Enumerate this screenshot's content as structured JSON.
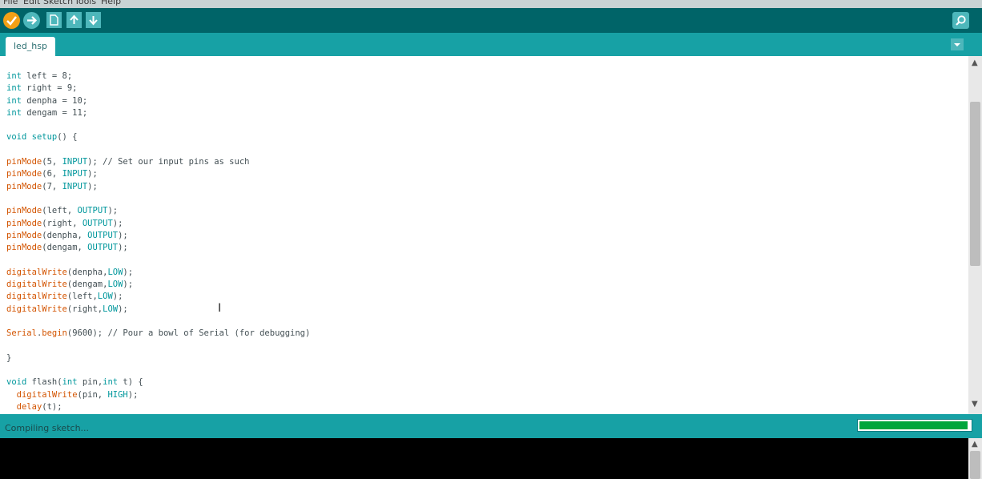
{
  "menu": [
    "File",
    "Edit",
    "Sketch",
    "Tools",
    "Help"
  ],
  "toolbar": {
    "verify": "check-icon",
    "upload": "arrow-right-icon",
    "new": "new-file-icon",
    "open": "open-arrow-up-icon",
    "save": "save-arrow-down-icon",
    "serial_monitor": "magnifier-icon"
  },
  "tabs": [
    {
      "label": "led_hsp",
      "active": true
    }
  ],
  "code_lines": [
    [
      {
        "t": "int",
        "c": "kw"
      },
      {
        "t": " left = 8;"
      }
    ],
    [
      {
        "t": "int",
        "c": "kw"
      },
      {
        "t": " right = 9;"
      }
    ],
    [
      {
        "t": "int",
        "c": "kw"
      },
      {
        "t": " denpha = 10;"
      }
    ],
    [
      {
        "t": "int",
        "c": "kw"
      },
      {
        "t": " dengam = 11;"
      }
    ],
    [],
    [
      {
        "t": "void",
        "c": "kw"
      },
      {
        "t": " "
      },
      {
        "t": "setup",
        "c": "kw"
      },
      {
        "t": "() {"
      }
    ],
    [],
    [
      {
        "t": "pinMode",
        "c": "fn"
      },
      {
        "t": "(5, "
      },
      {
        "t": "INPUT",
        "c": "kw"
      },
      {
        "t": "); "
      },
      {
        "t": "// Set our input pins as such",
        "c": "cm"
      }
    ],
    [
      {
        "t": "pinMode",
        "c": "fn"
      },
      {
        "t": "(6, "
      },
      {
        "t": "INPUT",
        "c": "kw"
      },
      {
        "t": ");"
      }
    ],
    [
      {
        "t": "pinMode",
        "c": "fn"
      },
      {
        "t": "(7, "
      },
      {
        "t": "INPUT",
        "c": "kw"
      },
      {
        "t": ");"
      }
    ],
    [],
    [
      {
        "t": "pinMode",
        "c": "fn"
      },
      {
        "t": "(left, "
      },
      {
        "t": "OUTPUT",
        "c": "kw"
      },
      {
        "t": ");"
      }
    ],
    [
      {
        "t": "pinMode",
        "c": "fn"
      },
      {
        "t": "(right, "
      },
      {
        "t": "OUTPUT",
        "c": "kw"
      },
      {
        "t": ");"
      }
    ],
    [
      {
        "t": "pinMode",
        "c": "fn"
      },
      {
        "t": "(denpha, "
      },
      {
        "t": "OUTPUT",
        "c": "kw"
      },
      {
        "t": ");"
      }
    ],
    [
      {
        "t": "pinMode",
        "c": "fn"
      },
      {
        "t": "(dengam, "
      },
      {
        "t": "OUTPUT",
        "c": "kw"
      },
      {
        "t": ");"
      }
    ],
    [],
    [
      {
        "t": "digitalWrite",
        "c": "fn"
      },
      {
        "t": "(denpha,"
      },
      {
        "t": "LOW",
        "c": "kw"
      },
      {
        "t": ");"
      }
    ],
    [
      {
        "t": "digitalWrite",
        "c": "fn"
      },
      {
        "t": "(dengam,"
      },
      {
        "t": "LOW",
        "c": "kw"
      },
      {
        "t": ");"
      }
    ],
    [
      {
        "t": "digitalWrite",
        "c": "fn"
      },
      {
        "t": "(left,"
      },
      {
        "t": "LOW",
        "c": "kw"
      },
      {
        "t": ");"
      }
    ],
    [
      {
        "t": "digitalWrite",
        "c": "fn"
      },
      {
        "t": "(right,"
      },
      {
        "t": "LOW",
        "c": "kw"
      },
      {
        "t": ");"
      }
    ],
    [],
    [
      {
        "t": "Serial",
        "c": "fn"
      },
      {
        "t": "."
      },
      {
        "t": "begin",
        "c": "fn"
      },
      {
        "t": "(9600); "
      },
      {
        "t": "// Pour a bowl of Serial (for debugging)",
        "c": "cm"
      }
    ],
    [],
    [
      {
        "t": "}"
      }
    ],
    [],
    [
      {
        "t": "void",
        "c": "kw"
      },
      {
        "t": " flash("
      },
      {
        "t": "int",
        "c": "kw"
      },
      {
        "t": " pin,"
      },
      {
        "t": "int",
        "c": "kw"
      },
      {
        "t": " t) {"
      }
    ],
    [
      {
        "t": "  "
      },
      {
        "t": "digitalWrite",
        "c": "fn"
      },
      {
        "t": "(pin, "
      },
      {
        "t": "HIGH",
        "c": "kw"
      },
      {
        "t": ");"
      }
    ],
    [
      {
        "t": "  "
      },
      {
        "t": "delay",
        "c": "fn"
      },
      {
        "t": "(t);"
      }
    ]
  ],
  "status": {
    "text": "Compiling sketch...",
    "progress_fraction": 0.98
  },
  "colors": {
    "toolbar": "#006468",
    "tabbar": "#17a1a5",
    "verify": "#f2a016",
    "button": "#4db7bb",
    "progress": "#00a63c"
  }
}
